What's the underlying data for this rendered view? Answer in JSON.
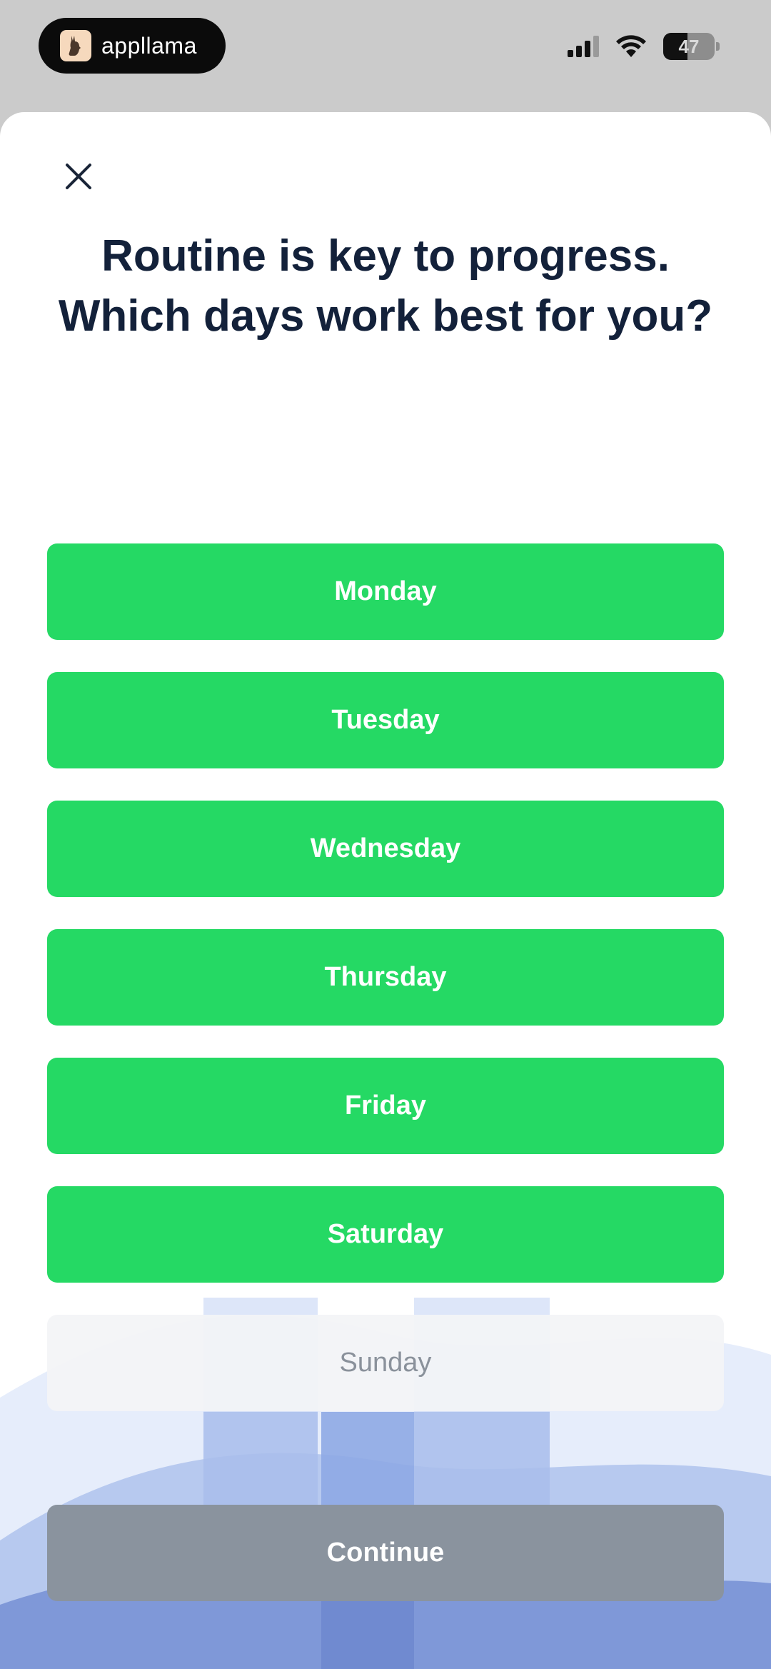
{
  "status_bar": {
    "brand_name": "appllama",
    "battery_level": 47,
    "battery_text": "47",
    "signal_bars": 4,
    "signal_bars_filled": 3
  },
  "header": {
    "close_icon": "close-icon",
    "title_line1": "Routine is key to progress.",
    "title_line2": "Which days work best for you?"
  },
  "days": [
    {
      "label": "Monday",
      "selected": true
    },
    {
      "label": "Tuesday",
      "selected": true
    },
    {
      "label": "Wednesday",
      "selected": true
    },
    {
      "label": "Thursday",
      "selected": true
    },
    {
      "label": "Friday",
      "selected": true
    },
    {
      "label": "Saturday",
      "selected": true
    },
    {
      "label": "Sunday",
      "selected": false
    }
  ],
  "footer": {
    "continue_label": "Continue"
  },
  "colors": {
    "selected_green": "#25d964",
    "unselected_gray": "#f3f4f6",
    "continue_disabled": "#8a939e",
    "title_navy": "#13213a"
  }
}
